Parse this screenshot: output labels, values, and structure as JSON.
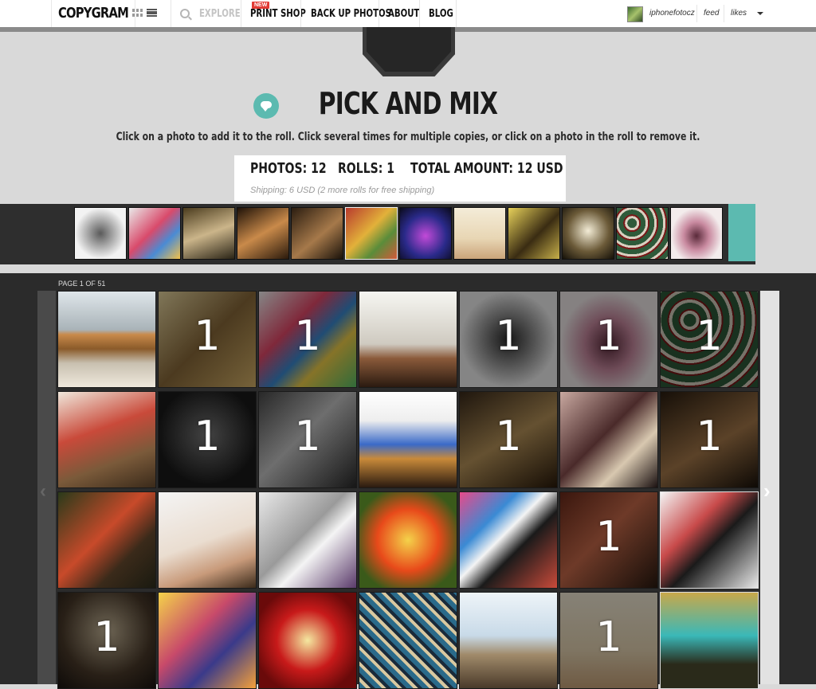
{
  "nav": {
    "logo": "COPYGRAM",
    "explore": "EXPLORE",
    "new_badge": "NEW",
    "print_shop": "PRINT SHOP",
    "back_up_photos": "BACK UP PHOTOS",
    "about": "ABOUT",
    "blog": "BLOG",
    "username": "iphonefotocz",
    "feed": "feed",
    "likes": "likes"
  },
  "header": {
    "title": "PICK AND MIX",
    "instructions": "Click on a photo to add it to the roll. Click several times for multiple copies, or click on a photo in the roll to remove it."
  },
  "summary": {
    "photos": "PHOTOS: 12",
    "rolls": "ROLLS: 1",
    "total": "TOTAL AMOUNT: 12 USD",
    "shipping": "Shipping: 6 USD (2 more rolls for free shipping)"
  },
  "pager": {
    "label": "PAGE 1 OF 51"
  },
  "grid": {
    "rows": [
      [
        "",
        "1",
        "1",
        "",
        "1",
        "1",
        "1"
      ],
      [
        "",
        "1",
        "1",
        "",
        "1",
        "",
        "1"
      ],
      [
        "",
        "",
        "",
        "",
        "",
        "1",
        ""
      ],
      [
        "1",
        "",
        "",
        "",
        "",
        "1",
        ""
      ]
    ]
  },
  "colors": {
    "accent": "#5cbab0",
    "dark_band": "#2b2b2b",
    "header_bg": "#d9d9d9"
  }
}
